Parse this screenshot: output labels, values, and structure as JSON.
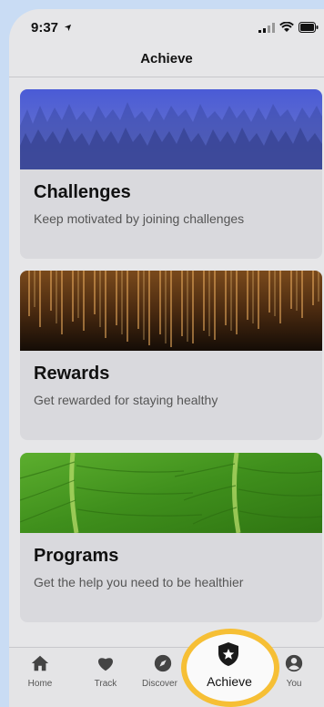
{
  "status_bar": {
    "time": "9:37"
  },
  "nav": {
    "title": "Achieve"
  },
  "cards": [
    {
      "title": "Challenges",
      "subtitle": "Keep motivated by joining challenges",
      "image": "misty-forest-image"
    },
    {
      "title": "Rewards",
      "subtitle": "Get rewarded for staying healthy",
      "image": "golden-light-streaks-image"
    },
    {
      "title": "Programs",
      "subtitle": "Get the help you need to be healthier",
      "image": "green-leaf-image"
    }
  ],
  "tabs": [
    {
      "label": "Home",
      "icon": "home-icon"
    },
    {
      "label": "Track",
      "icon": "heart-icon"
    },
    {
      "label": "Discover",
      "icon": "compass-icon"
    },
    {
      "label": "Achieve",
      "icon": "shield-star-icon",
      "active": true
    },
    {
      "label": "You",
      "icon": "person-icon"
    }
  ],
  "colors": {
    "highlight": "#f6bf35",
    "background": "#c9dcf4"
  }
}
